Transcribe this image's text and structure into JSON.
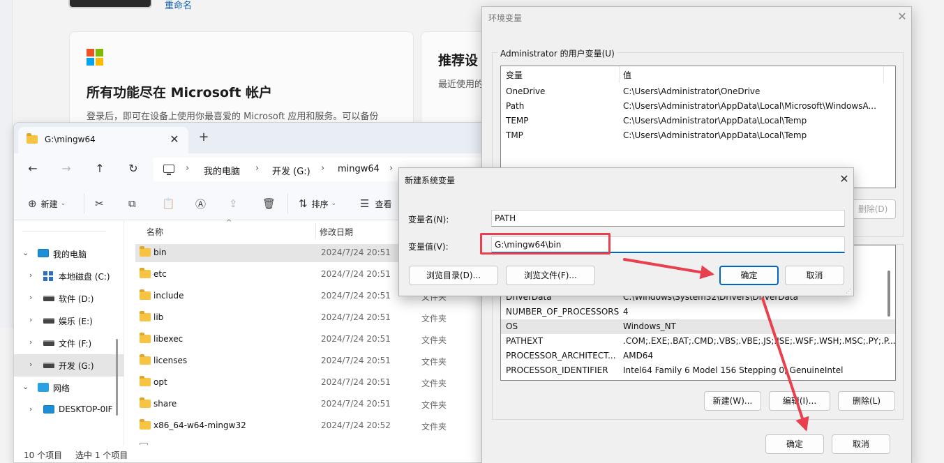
{
  "settings_bg": {
    "rename_link": "重命名",
    "ms_card": {
      "title": "所有功能尽在 Microsoft 帐户",
      "desc": "登录后，即可在设备上使用你最喜爱的 Microsoft 应用和服务。可以备份"
    },
    "rec_card": {
      "title": "推荐设",
      "sub": "最近使用的"
    },
    "logo_colors": [
      "#f25022",
      "#7fba00",
      "#00a4ef",
      "#ffb900"
    ]
  },
  "explorer": {
    "tab_title": "G:\\mingw64",
    "tab_close": "✕",
    "new_tab": "+",
    "breadcrumbs": [
      "我的电脑",
      "开发 (G:)",
      "mingw64"
    ],
    "toolbar": {
      "new_label": "新建",
      "sort_label": "排序",
      "view_label": "查看"
    },
    "nav_items": [
      {
        "label": "我的电脑",
        "chevron": "⌄",
        "icon": "pc-icon"
      },
      {
        "label": "本地磁盘 (C:)",
        "chevron": "›",
        "icon": "windows-drive-icon"
      },
      {
        "label": "软件 (D:)",
        "chevron": "›",
        "icon": "drive-icon"
      },
      {
        "label": "娱乐 (E:)",
        "chevron": "›",
        "icon": "drive-icon"
      },
      {
        "label": "文件 (F:)",
        "chevron": "›",
        "icon": "drive-icon"
      },
      {
        "label": "开发 (G:)",
        "chevron": "›",
        "icon": "drive-icon"
      },
      {
        "label": "网络",
        "chevron": "⌄",
        "icon": "network-icon"
      },
      {
        "label": "DESKTOP-0IF",
        "chevron": "›",
        "icon": "pc-icon"
      }
    ],
    "columns": {
      "name": "名称",
      "date": "修改日期"
    },
    "files": [
      {
        "name": "bin",
        "date": "2024/7/24 20:51",
        "type": ""
      },
      {
        "name": "etc",
        "date": "2024/7/24 20:51",
        "type": ""
      },
      {
        "name": "include",
        "date": "2024/7/24 20:51",
        "type": "文件夹"
      },
      {
        "name": "lib",
        "date": "2024/7/24 20:51",
        "type": "文件夹"
      },
      {
        "name": "libexec",
        "date": "2024/7/24 20:51",
        "type": "文件夹"
      },
      {
        "name": "licenses",
        "date": "2024/7/24 20:51",
        "type": "文件夹"
      },
      {
        "name": "opt",
        "date": "2024/7/24 20:51",
        "type": "文件夹"
      },
      {
        "name": "share",
        "date": "2024/7/24 20:51",
        "type": "文件夹"
      },
      {
        "name": "x86_64-w64-mingw32",
        "date": "2024/7/24 20:52",
        "type": "文件夹"
      }
    ],
    "status": {
      "count": "10 个项目",
      "selected": "选中 1 个项目"
    }
  },
  "env_dialog": {
    "title": "环境变量",
    "close": "✕",
    "user_group_label": "Administrator 的用户变量(U)",
    "headers": {
      "name": "变量",
      "value": "值"
    },
    "user_vars": [
      {
        "name": "OneDrive",
        "value": "C:\\Users\\Administrator\\OneDrive"
      },
      {
        "name": "Path",
        "value": "C:\\Users\\Administrator\\AppData\\Local\\Microsoft\\WindowsA..."
      },
      {
        "name": "TEMP",
        "value": "C:\\Users\\Administrator\\AppData\\Local\\Temp"
      },
      {
        "name": "TMP",
        "value": "C:\\Users\\Administrator\\AppData\\Local\\Temp"
      }
    ],
    "user_delete_btn": "删除(D)",
    "system_vars": [
      {
        "name": "DriverData",
        "value": "C:\\Windows\\System32\\Drivers\\DriverData"
      },
      {
        "name": "NUMBER_OF_PROCESSORS",
        "value": "4"
      },
      {
        "name": "OS",
        "value": "Windows_NT"
      },
      {
        "name": "PATHEXT",
        "value": ".COM;.EXE;.BAT;.CMD;.VBS;.VBE;.JS;.JSE;.WSF;.WSH;.MSC;.PY;.P..."
      },
      {
        "name": "PROCESSOR_ARCHITECT...",
        "value": "AMD64"
      },
      {
        "name": "PROCESSOR_IDENTIFIER",
        "value": "Intel64 Family 6 Model 156 Stepping 0, GenuineIntel"
      }
    ],
    "sys_buttons": {
      "new": "新建(W)...",
      "edit": "编辑(I)...",
      "delete": "删除(L)"
    },
    "ok": "确定",
    "cancel": "取消"
  },
  "new_var_dialog": {
    "title": "新建系统变量",
    "close": "✕",
    "name_label": "变量名(N):",
    "name_value": "PATH",
    "value_label": "变量值(V):",
    "value_value": "G:\\mingw64\\bin",
    "browse_dir": "浏览目录(D)...",
    "browse_file": "浏览文件(F)...",
    "ok": "确定",
    "cancel": "取消"
  },
  "annotation_color": "#e8404e"
}
